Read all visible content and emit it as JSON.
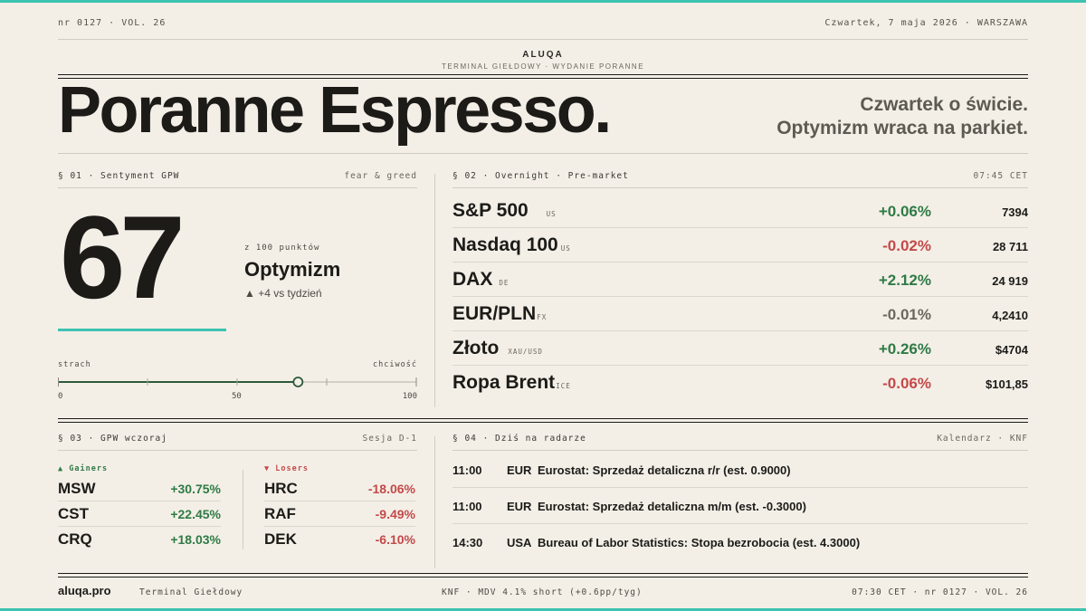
{
  "header": {
    "issue": "nr 0127 · VOL. 26",
    "dateline": "Czwartek, 7 maja 2026 · WARSZAWA",
    "brand": "ALUQA",
    "brand_sub": "TERMINAL GIEŁDOWY · WYDANIE PORANNE",
    "title": "Poranne Espresso.",
    "tagline_1": "Czwartek o świcie.",
    "tagline_2": "Optymizm wraca na parkiet."
  },
  "colors": {
    "accent": "#3cc3b1",
    "up": "#2f7a45",
    "down": "#c44949",
    "background": "#f3efe7"
  },
  "sentiment": {
    "section": "§ 01 · Sentyment GPW",
    "section_right": "fear & greed",
    "value": "67",
    "value_numeric": 67,
    "scale_min": 0,
    "scale_max": 100,
    "points_label": "z 100 punktów",
    "label": "Optymizm",
    "change_icon": "triangle-up-icon",
    "change": "▲ +4 vs tydzień",
    "scale_left": "strach",
    "scale_right": "chciwość",
    "tick_0": "0",
    "tick_50": "50",
    "tick_100": "100"
  },
  "overnight": {
    "section": "§ 02 · Overnight · Pre-market",
    "time": "07:45 CET",
    "rows": [
      {
        "name": "S&P 500",
        "tag": "US",
        "change": "+0.06%",
        "dir": "up",
        "value": "7394"
      },
      {
        "name": "Nasdaq 100",
        "tag": "US",
        "change": "-0.02%",
        "dir": "down",
        "value": "28 711"
      },
      {
        "name": "DAX",
        "tag": "DE",
        "change": "+2.12%",
        "dir": "up",
        "value": "24 919"
      },
      {
        "name": "EUR/PLN",
        "tag": "FX",
        "change": "-0.01%",
        "dir": "flat",
        "value": "4,2410"
      },
      {
        "name": "Złoto",
        "tag": "XAU/USD",
        "change": "+0.26%",
        "dir": "up",
        "value": "$4704"
      },
      {
        "name": "Ropa Brent",
        "tag": "ICE",
        "change": "-0.06%",
        "dir": "down",
        "value": "$101,85"
      }
    ]
  },
  "gpw": {
    "section": "§ 03 · GPW wczoraj",
    "section_right": "Sesja D-1",
    "gainers_label": "▲ Gainers",
    "losers_label": "▼ Losers",
    "gainers": [
      {
        "ticker": "MSW",
        "pct": "+30.75%"
      },
      {
        "ticker": "CST",
        "pct": "+22.45%"
      },
      {
        "ticker": "CRQ",
        "pct": "+18.03%"
      }
    ],
    "losers": [
      {
        "ticker": "HRC",
        "pct": "-18.06%"
      },
      {
        "ticker": "RAF",
        "pct": "-9.49%"
      },
      {
        "ticker": "DEK",
        "pct": "-6.10%"
      }
    ]
  },
  "radar": {
    "section": "§ 04 · Dziś na radarze",
    "section_right": "Kalendarz · KNF",
    "events": [
      {
        "time": "11:00",
        "ccy": "EUR",
        "text": "Eurostat: Sprzedaż detaliczna r/r (est. 0.9000)"
      },
      {
        "time": "11:00",
        "ccy": "EUR",
        "text": "Eurostat: Sprzedaż detaliczna m/m (est. -0.3000)"
      },
      {
        "time": "14:30",
        "ccy": "USA",
        "text": "Bureau of Labor Statistics: Stopa bezrobocia (est. 4.3000)"
      }
    ]
  },
  "footer": {
    "site": "aluqa.pro",
    "terminal": "Terminal Giełdowy",
    "knf": "KNF · MDV 4.1% short (+0.6pp/tyg)",
    "right": "07:30 CET · nr 0127 · VOL. 26"
  }
}
